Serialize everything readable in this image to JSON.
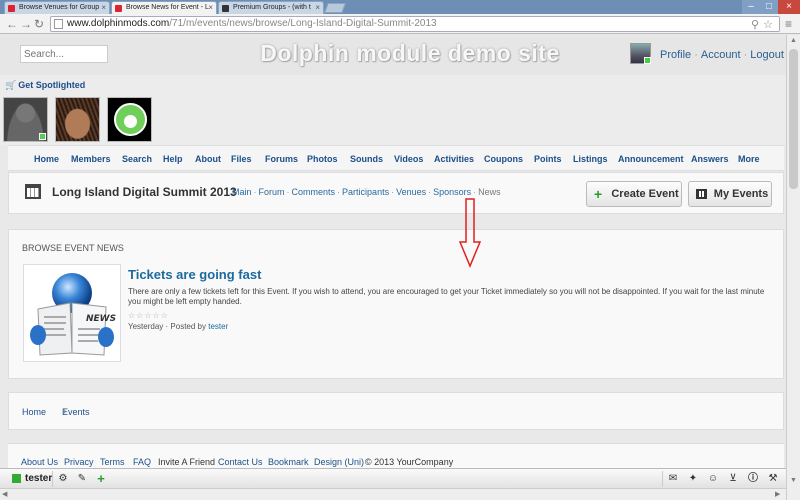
{
  "browser": {
    "tabs": [
      {
        "title": "Browse Venues for Group"
      },
      {
        "title": "Browse News for Event - L"
      },
      {
        "title": "Premium Groups - (with t"
      }
    ],
    "address": {
      "host": "www.dolphinmods.com",
      "path": "/71/m/events/news/browse/Long-Island-Digital-Summit-2013"
    },
    "icons": {
      "back": "back-arrow-icon",
      "forward": "forward-arrow-icon",
      "reload": "reload-icon",
      "search": "search-icon",
      "star": "star-icon",
      "menu": "menu-icon"
    }
  },
  "header": {
    "search_placeholder": "Search...",
    "site_title": "Dolphin module demo site",
    "links": {
      "profile": "Profile",
      "account": "Account",
      "logout": "Logout"
    }
  },
  "spotlight": {
    "label": "Get Spotlighted"
  },
  "nav": [
    "Home",
    "Members",
    "Search",
    "Help",
    "About",
    "Files",
    "Forums",
    "Photos",
    "Sounds",
    "Videos",
    "Activities",
    "Coupons",
    "Points",
    "Listings",
    "Announcement",
    "Answers",
    "More"
  ],
  "event": {
    "title": "Long Island Digital Summit 2013",
    "tabs": [
      "Main",
      "Forum",
      "Comments",
      "Participants",
      "Venues",
      "Sponsors",
      "News"
    ],
    "buttons": {
      "create": "Create Event",
      "my": "My Events"
    }
  },
  "news": {
    "caption": "Browse Event News",
    "thumb_text": "NEWS",
    "item": {
      "title": "Tickets are going fast",
      "body": "There are only a few tickets left for this Event. If you wish to attend, you are encouraged to get your Ticket immediately so you will not be disappointed. If you wait for the last minute you might be left empty handed.",
      "when": "Yesterday",
      "posted_by": "Posted by",
      "author": "tester",
      "rating": 0,
      "rating_max": 5
    }
  },
  "breadcrumb": {
    "home": "Home",
    "sep": "›",
    "current": "Events"
  },
  "footer": {
    "links": [
      "About Us",
      "Privacy",
      "Terms",
      "FAQ",
      "Invite A Friend",
      "Contact Us",
      "Bookmark",
      "Design (Uni)"
    ],
    "copyright": "© 2013 YourCompany"
  },
  "bottombar": {
    "user": "tester",
    "icons": [
      "settings-gear-icon",
      "edit-icon",
      "add-icon",
      "mail-icon",
      "twitter-icon",
      "friends-icon",
      "cart-icon",
      "info-icon",
      "wrench-icon"
    ]
  },
  "colors": {
    "link": "#1d4f8a",
    "annotation_arrow": "#e02020",
    "online": "#44cc44"
  }
}
